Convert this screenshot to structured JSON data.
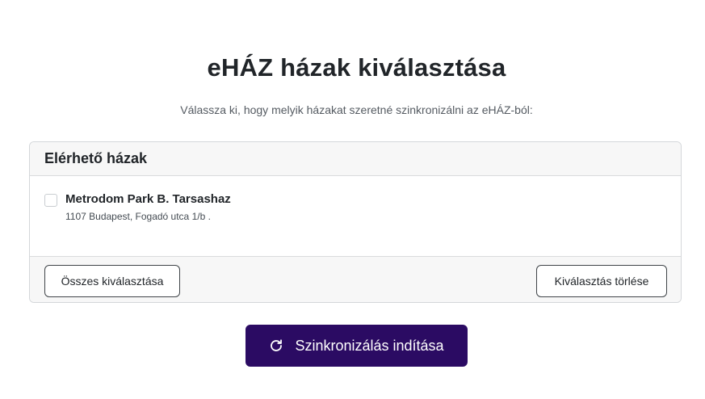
{
  "header": {
    "title": "eHÁZ házak kiválasztása",
    "subtitle": "Válassza ki, hogy melyik házakat szeretné szinkronizálni az eHÁZ-ból:"
  },
  "houses_card": {
    "title": "Elérhető házak",
    "items": [
      {
        "name": "Metrodom Park B. Tarsashaz",
        "address": "1107 Budapest, Fogadó utca 1/b .",
        "checked": false
      }
    ],
    "select_all_label": "Összes kiválasztása",
    "clear_label": "Kiválasztás törlése"
  },
  "sync_button": {
    "label": "Szinkronizálás indítása",
    "icon": "refresh-icon"
  },
  "colors": {
    "primary": "#2b0b63",
    "card_header_bg": "#f7f7f7",
    "border": "#d4d7da"
  }
}
